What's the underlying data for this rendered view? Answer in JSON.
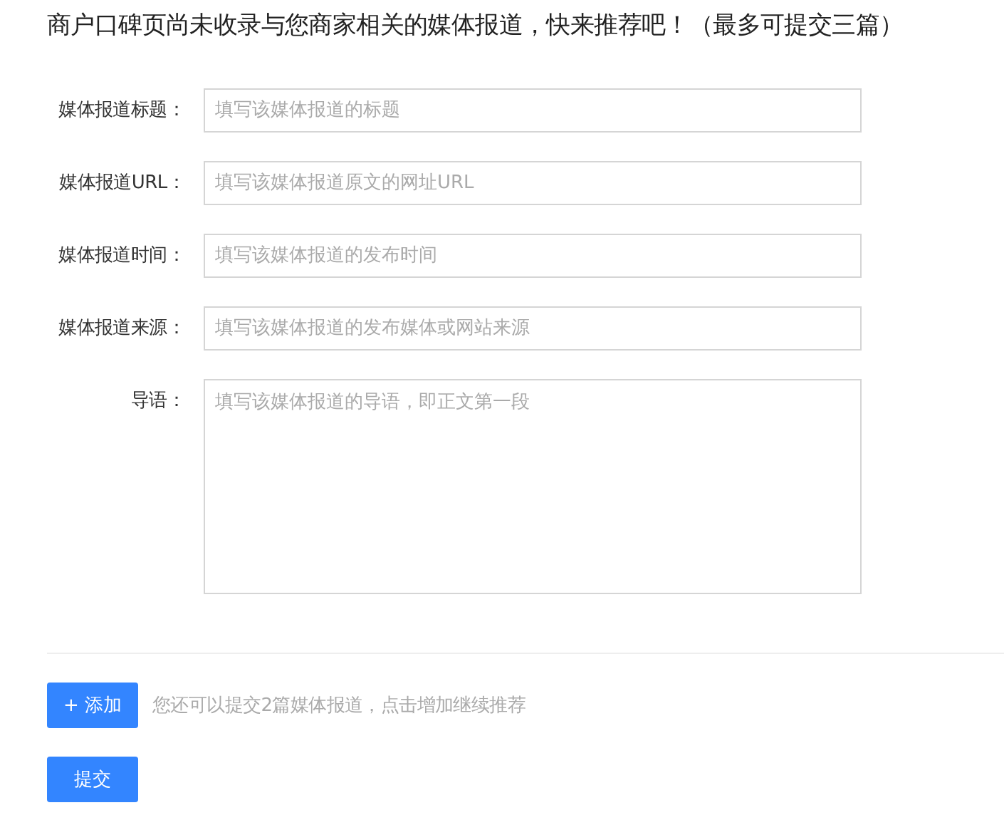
{
  "heading": "商户口碑页尚未收录与您商家相关的媒体报道，快来推荐吧！（最多可提交三篇）",
  "fields": [
    {
      "label": "媒体报道标题：",
      "placeholder": "填写该媒体报道的标题",
      "kind": "input"
    },
    {
      "label": "媒体报道URL：",
      "placeholder": "填写该媒体报道原文的网址URL",
      "kind": "input"
    },
    {
      "label": "媒体报道时间：",
      "placeholder": "填写该媒体报道的发布时间",
      "kind": "input"
    },
    {
      "label": "媒体报道来源：",
      "placeholder": "填写该媒体报道的发布媒体或网站来源",
      "kind": "input"
    },
    {
      "label": "导语：",
      "placeholder": "填写该媒体报道的导语，即正文第一段",
      "kind": "textarea"
    }
  ],
  "add_button": "+ 添加",
  "add_hint": "您还可以提交2篇媒体报道，点击增加继续推荐",
  "submit_button": "提交"
}
